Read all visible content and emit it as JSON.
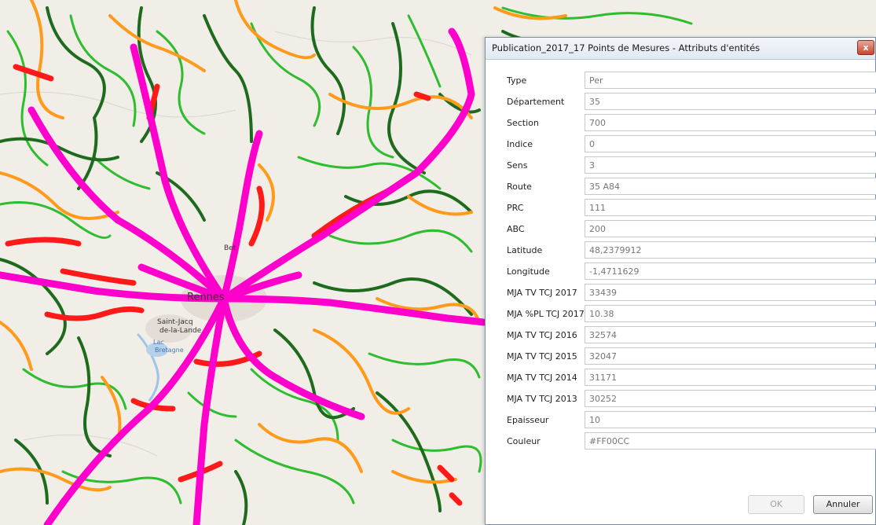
{
  "map": {
    "place_labels": [
      "Rennes",
      "Saint-Jacq",
      "de-la-Lande",
      "Bet",
      "Lac",
      "Bretagne"
    ],
    "colors": {
      "background": "#f2efe9",
      "motorway": "#ff00cc",
      "major": "#ff1a1a",
      "secondary": "#ff9a1a",
      "minor": "#1e6b1e",
      "local": "#2ebd2e"
    }
  },
  "dialog": {
    "title": "Publication_2017_17 Points de Mesures - Attributs d'entités",
    "close_glyph": "x",
    "fields": [
      {
        "label": "Type",
        "value": "Per"
      },
      {
        "label": "Département",
        "value": "35"
      },
      {
        "label": "Section",
        "value": "700"
      },
      {
        "label": "Indice",
        "value": "0"
      },
      {
        "label": "Sens",
        "value": "3"
      },
      {
        "label": "Route",
        "value": "35 A84"
      },
      {
        "label": "PRC",
        "value": "111"
      },
      {
        "label": "ABC",
        "value": "200"
      },
      {
        "label": "Latitude",
        "value": "48,2379912"
      },
      {
        "label": "Longitude",
        "value": "-1,4711629"
      },
      {
        "label": "MJA TV TCJ 2017",
        "value": "33439"
      },
      {
        "label": "MJA %PL TCJ 2017",
        "value": "10.38"
      },
      {
        "label": "MJA TV TCJ 2016",
        "value": "32574"
      },
      {
        "label": "MJA TV TCJ 2015",
        "value": "32047"
      },
      {
        "label": "MJA TV TCJ 2014",
        "value": "31171"
      },
      {
        "label": "MJA TV TCJ 2013",
        "value": "30252"
      },
      {
        "label": "Epaisseur",
        "value": "10"
      },
      {
        "label": "Couleur",
        "value": "#FF00CC"
      }
    ],
    "buttons": {
      "ok": "OK",
      "cancel": "Annuler"
    }
  }
}
